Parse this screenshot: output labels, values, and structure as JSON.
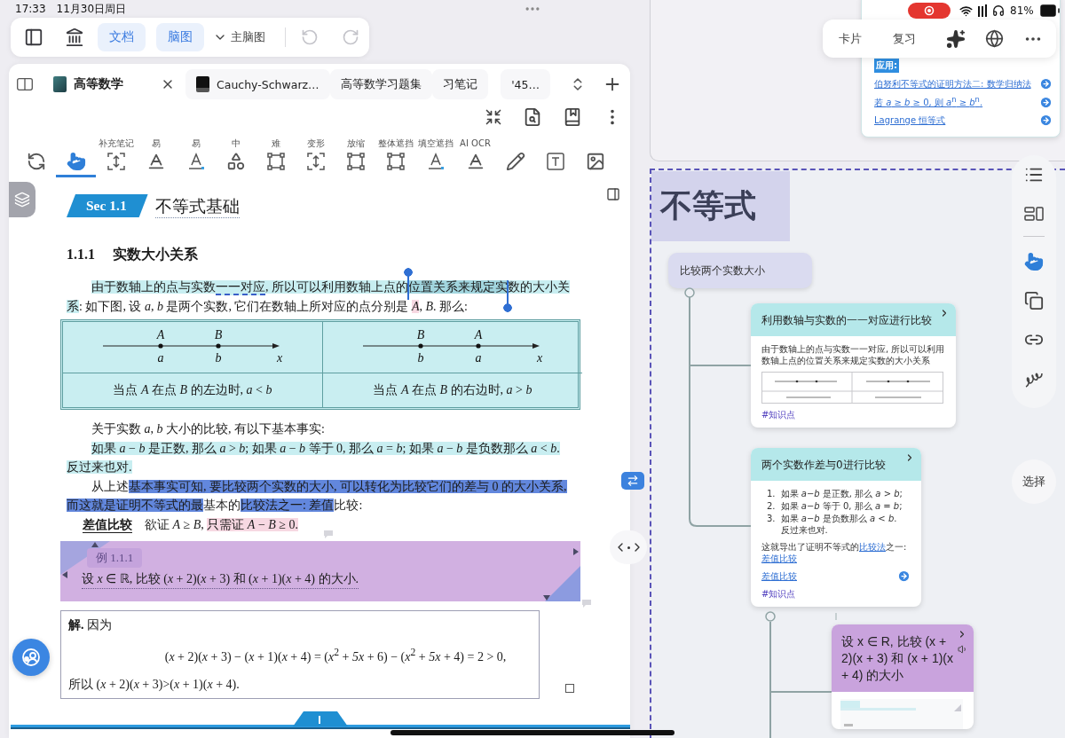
{
  "status_bar": {
    "time": "17:33",
    "date": "11月30日周日",
    "battery": "81%"
  },
  "top_toolbar": {
    "views": [
      {
        "label": "文档",
        "selected": true
      },
      {
        "label": "脑图",
        "selected": true
      }
    ],
    "mindmap_menu": "主脑图",
    "undo": {
      "disabled": true
    },
    "redo": {
      "disabled": true
    }
  },
  "doc_tabs": [
    {
      "kind": "book",
      "title": "高等数学",
      "selected": true
    },
    {
      "kind": "terminal",
      "title": "Cauchy-Schwarz…",
      "selected": false
    },
    {
      "kind": "plain",
      "title": "高等数学习题集",
      "selected": false
    },
    {
      "kind": "plain",
      "title": "习笔记",
      "selected": false
    },
    {
      "kind": "plain",
      "title": "'45…",
      "selected": false
    }
  ],
  "tools": [
    {
      "kind": "rotate",
      "selected": false
    },
    {
      "kind": "hand",
      "selected": true
    },
    {
      "kind": "insert",
      "label": "补充笔记",
      "selected": false
    },
    {
      "kind": "underline",
      "label": "易",
      "selected": false
    },
    {
      "kind": "underline-dot",
      "label": "易",
      "selected": false
    },
    {
      "kind": "shape",
      "label": "中",
      "selected": false
    },
    {
      "kind": "frame",
      "label": "难",
      "selected": false
    },
    {
      "kind": "insert",
      "label": "变形",
      "selected": false
    },
    {
      "kind": "frame",
      "label": "放缩",
      "selected": false
    },
    {
      "kind": "frame",
      "label": "整体遮挡",
      "selected": false
    },
    {
      "kind": "underline-dot",
      "label": "填空遮挡",
      "selected": false
    },
    {
      "kind": "underline",
      "label": "AI OCR",
      "selected": false
    },
    {
      "kind": "pencil",
      "selected": false
    },
    {
      "kind": "textbox",
      "selected": false
    },
    {
      "kind": "image",
      "selected": false
    }
  ],
  "document": {
    "section": {
      "number": "Sec 1.1",
      "title": "不等式基础"
    },
    "subsection": {
      "number": "1.1.1",
      "title": "实数大小关系"
    },
    "intro": [
      {
        "segments": [
          {
            "text": "由于数轴上的点与实数",
            "color": "#c8eef1",
            "selected": false,
            "underlined": false
          },
          {
            "text": "一一对应",
            "color": "#c8eef1",
            "selected": false,
            "underlined": true
          },
          {
            "text": ", 所以可以利用数轴上点的",
            "color": "#c8eef1",
            "selected": false,
            "underlined": false
          },
          {
            "text": "位置关系来规定实",
            "color": "#a2d6df",
            "selected": true,
            "underlined": false
          },
          {
            "text": "数的大小关",
            "color": "#c8eef1",
            "selected": false,
            "underlined": false
          }
        ]
      },
      {
        "segments": [
          {
            "text": "系",
            "color": "#c8eef1",
            "selected": false,
            "underlined": false
          },
          {
            "text": ": 如下图, 设 *a*, *b* 是两个实数, 它们在数轴上所对应的点分别是 ",
            "selected": false,
            "underlined": false
          },
          {
            "text": "*A*",
            "color": "#f7d8e2",
            "selected": false,
            "underlined": false
          },
          {
            "text": ", *B*. 那么:",
            "selected": false,
            "underlined": false
          }
        ]
      }
    ],
    "figure": {
      "cells": [
        {
          "points": [
            {
              "upper": "A",
              "lower": "a"
            },
            {
              "upper": "B",
              "lower": "b"
            }
          ],
          "axis": "x",
          "caption": "当点 *A* 在点 *B* 的左边时, *a* < *b*"
        },
        {
          "points": [
            {
              "upper": "B",
              "lower": "b"
            },
            {
              "upper": "A",
              "lower": "a"
            }
          ],
          "axis": "x",
          "caption": "当点 *A* 在点 *B* 的右边时, *a* > *b*"
        }
      ]
    },
    "facts_lead": "关于实数 *a*, *b* 大小的比较, 有以下基本事实:",
    "facts": [
      {
        "segments": [
          {
            "text": "如果 *a* − *b* 是正数, 那么 *a* > *b*; 如果 *a* − *b* 等于 0, 那么 *a* = *b*; 如果 *a* − *b* 是负数那么 *a* < *b*.",
            "color": "#c8eef1"
          }
        ]
      },
      {
        "segments": [
          {
            "text": "反过来也对.",
            "color": "#c8eef1"
          }
        ]
      }
    ],
    "conclusion": [
      {
        "segments": [
          {
            "text": "从上述"
          },
          {
            "text": "基本事实可知, 要比较两个实数的大小, 可以转化为比较它们的差与 0 的大小关系,",
            "color": "#6287dd"
          }
        ]
      },
      {
        "segments": [
          {
            "text": "而这就是证明不等式的最",
            "color": "#6287dd"
          },
          {
            "text": "基本的"
          },
          {
            "text": "比较法之一: 差值",
            "color": "#6287dd"
          },
          {
            "text": "比较:"
          }
        ]
      }
    ],
    "definition": {
      "term": "差值比较",
      "segments": [
        {
          "text": "欲证 *A* ≥ *B*, "
        },
        {
          "text": "只需证 *A* − *B* ≥ 0.",
          "color": "#f7d8e2"
        }
      ]
    },
    "example": {
      "label": "例 1.1.1",
      "text": "设 *x* ∈ ℝ, 比较 (*x* + 2)(*x* + 3) 和 (*x* + 1)(*x* + 4) 的大小."
    },
    "solution": {
      "lead": "**解.**  因为",
      "formula": "(*x* + 2)(*x* + 3) − (*x* + 1)(*x* + 4) = (*x*$^{2}$ + *5x* + 6) − (*x*$^{2}$ + *5x* + 4) = 2 > 0,",
      "conclusion": "所以 (*x* + 2)(*x* + 3)>(*x* + 1)(*x* + 4)."
    }
  },
  "upper_card": {
    "heading": "应用:",
    "links": [
      "伯努利不等式的证明方法二: 数学归纳法",
      "若 *a* ≥ *b* ≥ 0, 则 *a*$^{n}$ ≥ *b*$^{n}$.",
      "Lagrange 恒等式"
    ]
  },
  "card_toolbar": {
    "buttons": [
      "卡片",
      "复习"
    ]
  },
  "mindmap": {
    "root": "不等式",
    "branch": "比较两个实数大小",
    "cards": [
      {
        "kind": "figure",
        "color": "#b5e8ea",
        "title": "利用数轴与实数的一一对应进行比较",
        "text": "由于数轴上的点与实数一一对应, 所以可以利用数轴上点的位置关系来规定实数的大小关系",
        "tag": "#知识点"
      },
      {
        "kind": "list",
        "color": "#b5e8ea",
        "title": "两个实数作差与0进行比较",
        "items": [
          {
            "number": "1.",
            "text": "如果 *a*−*b* 是正数, 那么 *a* > *b*;"
          },
          {
            "number": "2.",
            "text": "如果 *a*−*b* 等于 0, 那么 *a* = *b*;"
          },
          {
            "number": "3.",
            "text": "如果 *a*−*b* 是负数那么 *a* < *b*.",
            "extra": "反过来也对."
          }
        ],
        "summary": [
          {
            "text": "这就导出了证明不等式的",
            "link": false
          },
          {
            "text": "比较法",
            "link": true
          },
          {
            "text": "之一: ",
            "link": false
          },
          {
            "text": "差值比较",
            "link": true
          }
        ],
        "link": "差值比较",
        "tag": "#知识点"
      },
      {
        "kind": "preview",
        "color": "#c9a3dd",
        "title": "设 x ∈ R, 比较 (x + 2)(x + 3) 和 (x + 1)(x + 4) 的大小"
      }
    ]
  },
  "side_tools": [
    {
      "kind": "outline",
      "selected": false
    },
    {
      "kind": "layout",
      "selected": false
    },
    {
      "kind": "hand",
      "selected": true
    },
    {
      "kind": "copy",
      "selected": false
    },
    {
      "kind": "link",
      "selected": false
    },
    {
      "kind": "draw",
      "selected": false
    }
  ],
  "select_button": "选择"
}
